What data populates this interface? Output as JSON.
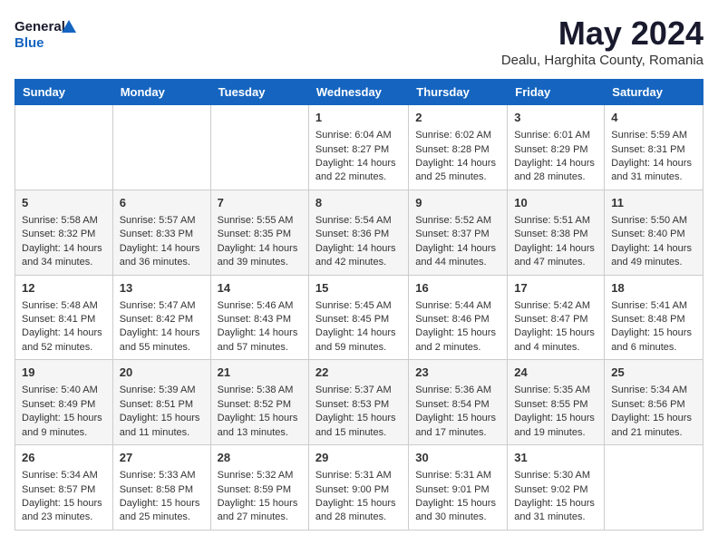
{
  "logo": {
    "line1": "General",
    "line2": "Blue"
  },
  "title": "May 2024",
  "subtitle": "Dealu, Harghita County, Romania",
  "days_of_week": [
    "Sunday",
    "Monday",
    "Tuesday",
    "Wednesday",
    "Thursday",
    "Friday",
    "Saturday"
  ],
  "weeks": [
    [
      {
        "day": "",
        "sunrise": "",
        "sunset": "",
        "daylight": ""
      },
      {
        "day": "",
        "sunrise": "",
        "sunset": "",
        "daylight": ""
      },
      {
        "day": "",
        "sunrise": "",
        "sunset": "",
        "daylight": ""
      },
      {
        "day": "1",
        "sunrise": "Sunrise: 6:04 AM",
        "sunset": "Sunset: 8:27 PM",
        "daylight": "Daylight: 14 hours and 22 minutes."
      },
      {
        "day": "2",
        "sunrise": "Sunrise: 6:02 AM",
        "sunset": "Sunset: 8:28 PM",
        "daylight": "Daylight: 14 hours and 25 minutes."
      },
      {
        "day": "3",
        "sunrise": "Sunrise: 6:01 AM",
        "sunset": "Sunset: 8:29 PM",
        "daylight": "Daylight: 14 hours and 28 minutes."
      },
      {
        "day": "4",
        "sunrise": "Sunrise: 5:59 AM",
        "sunset": "Sunset: 8:31 PM",
        "daylight": "Daylight: 14 hours and 31 minutes."
      }
    ],
    [
      {
        "day": "5",
        "sunrise": "Sunrise: 5:58 AM",
        "sunset": "Sunset: 8:32 PM",
        "daylight": "Daylight: 14 hours and 34 minutes."
      },
      {
        "day": "6",
        "sunrise": "Sunrise: 5:57 AM",
        "sunset": "Sunset: 8:33 PM",
        "daylight": "Daylight: 14 hours and 36 minutes."
      },
      {
        "day": "7",
        "sunrise": "Sunrise: 5:55 AM",
        "sunset": "Sunset: 8:35 PM",
        "daylight": "Daylight: 14 hours and 39 minutes."
      },
      {
        "day": "8",
        "sunrise": "Sunrise: 5:54 AM",
        "sunset": "Sunset: 8:36 PM",
        "daylight": "Daylight: 14 hours and 42 minutes."
      },
      {
        "day": "9",
        "sunrise": "Sunrise: 5:52 AM",
        "sunset": "Sunset: 8:37 PM",
        "daylight": "Daylight: 14 hours and 44 minutes."
      },
      {
        "day": "10",
        "sunrise": "Sunrise: 5:51 AM",
        "sunset": "Sunset: 8:38 PM",
        "daylight": "Daylight: 14 hours and 47 minutes."
      },
      {
        "day": "11",
        "sunrise": "Sunrise: 5:50 AM",
        "sunset": "Sunset: 8:40 PM",
        "daylight": "Daylight: 14 hours and 49 minutes."
      }
    ],
    [
      {
        "day": "12",
        "sunrise": "Sunrise: 5:48 AM",
        "sunset": "Sunset: 8:41 PM",
        "daylight": "Daylight: 14 hours and 52 minutes."
      },
      {
        "day": "13",
        "sunrise": "Sunrise: 5:47 AM",
        "sunset": "Sunset: 8:42 PM",
        "daylight": "Daylight: 14 hours and 55 minutes."
      },
      {
        "day": "14",
        "sunrise": "Sunrise: 5:46 AM",
        "sunset": "Sunset: 8:43 PM",
        "daylight": "Daylight: 14 hours and 57 minutes."
      },
      {
        "day": "15",
        "sunrise": "Sunrise: 5:45 AM",
        "sunset": "Sunset: 8:45 PM",
        "daylight": "Daylight: 14 hours and 59 minutes."
      },
      {
        "day": "16",
        "sunrise": "Sunrise: 5:44 AM",
        "sunset": "Sunset: 8:46 PM",
        "daylight": "Daylight: 15 hours and 2 minutes."
      },
      {
        "day": "17",
        "sunrise": "Sunrise: 5:42 AM",
        "sunset": "Sunset: 8:47 PM",
        "daylight": "Daylight: 15 hours and 4 minutes."
      },
      {
        "day": "18",
        "sunrise": "Sunrise: 5:41 AM",
        "sunset": "Sunset: 8:48 PM",
        "daylight": "Daylight: 15 hours and 6 minutes."
      }
    ],
    [
      {
        "day": "19",
        "sunrise": "Sunrise: 5:40 AM",
        "sunset": "Sunset: 8:49 PM",
        "daylight": "Daylight: 15 hours and 9 minutes."
      },
      {
        "day": "20",
        "sunrise": "Sunrise: 5:39 AM",
        "sunset": "Sunset: 8:51 PM",
        "daylight": "Daylight: 15 hours and 11 minutes."
      },
      {
        "day": "21",
        "sunrise": "Sunrise: 5:38 AM",
        "sunset": "Sunset: 8:52 PM",
        "daylight": "Daylight: 15 hours and 13 minutes."
      },
      {
        "day": "22",
        "sunrise": "Sunrise: 5:37 AM",
        "sunset": "Sunset: 8:53 PM",
        "daylight": "Daylight: 15 hours and 15 minutes."
      },
      {
        "day": "23",
        "sunrise": "Sunrise: 5:36 AM",
        "sunset": "Sunset: 8:54 PM",
        "daylight": "Daylight: 15 hours and 17 minutes."
      },
      {
        "day": "24",
        "sunrise": "Sunrise: 5:35 AM",
        "sunset": "Sunset: 8:55 PM",
        "daylight": "Daylight: 15 hours and 19 minutes."
      },
      {
        "day": "25",
        "sunrise": "Sunrise: 5:34 AM",
        "sunset": "Sunset: 8:56 PM",
        "daylight": "Daylight: 15 hours and 21 minutes."
      }
    ],
    [
      {
        "day": "26",
        "sunrise": "Sunrise: 5:34 AM",
        "sunset": "Sunset: 8:57 PM",
        "daylight": "Daylight: 15 hours and 23 minutes."
      },
      {
        "day": "27",
        "sunrise": "Sunrise: 5:33 AM",
        "sunset": "Sunset: 8:58 PM",
        "daylight": "Daylight: 15 hours and 25 minutes."
      },
      {
        "day": "28",
        "sunrise": "Sunrise: 5:32 AM",
        "sunset": "Sunset: 8:59 PM",
        "daylight": "Daylight: 15 hours and 27 minutes."
      },
      {
        "day": "29",
        "sunrise": "Sunrise: 5:31 AM",
        "sunset": "Sunset: 9:00 PM",
        "daylight": "Daylight: 15 hours and 28 minutes."
      },
      {
        "day": "30",
        "sunrise": "Sunrise: 5:31 AM",
        "sunset": "Sunset: 9:01 PM",
        "daylight": "Daylight: 15 hours and 30 minutes."
      },
      {
        "day": "31",
        "sunrise": "Sunrise: 5:30 AM",
        "sunset": "Sunset: 9:02 PM",
        "daylight": "Daylight: 15 hours and 31 minutes."
      },
      {
        "day": "",
        "sunrise": "",
        "sunset": "",
        "daylight": ""
      }
    ]
  ]
}
